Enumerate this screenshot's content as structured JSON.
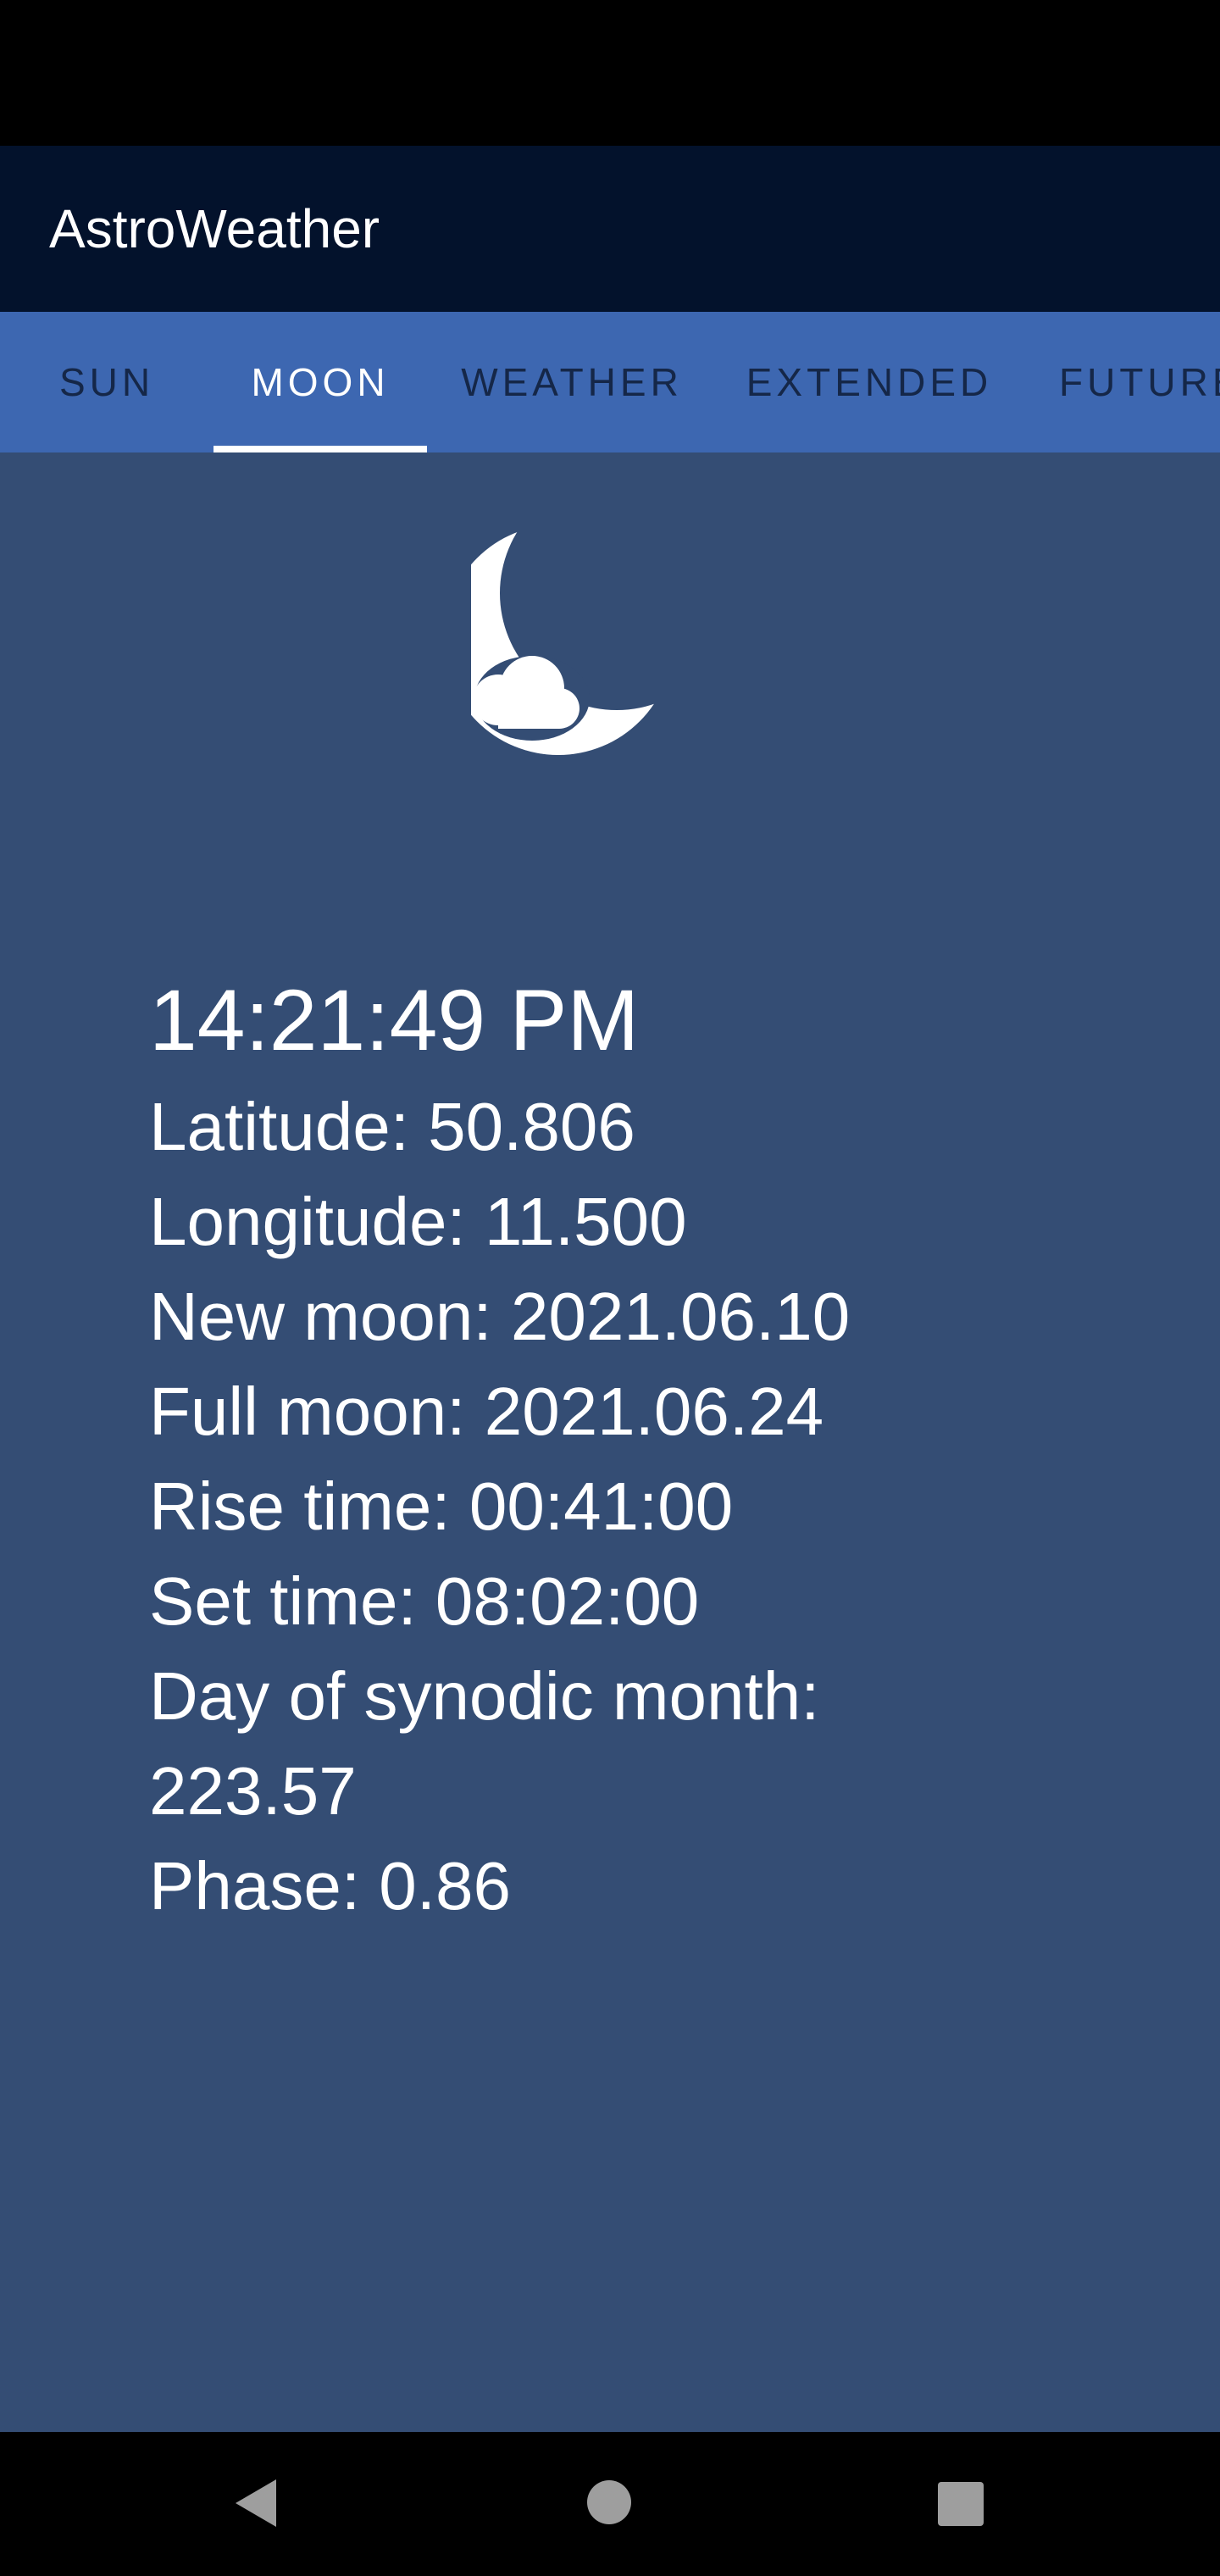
{
  "app": {
    "title": "AstroWeather"
  },
  "tabs": [
    {
      "label": "SUN",
      "selected": false
    },
    {
      "label": "MOON",
      "selected": true
    },
    {
      "label": "WEATHER",
      "selected": false
    },
    {
      "label": "EXTENDED",
      "selected": false
    },
    {
      "label": "FUTURE",
      "selected": false
    }
  ],
  "moon": {
    "icon": "moon-cloud-icon",
    "time": "14:21:49 PM",
    "latitude": "Latitude: 50.806",
    "longitude": "Longitude: 11.500",
    "new_moon": "New moon: 2021.06.10",
    "full_moon": "Full moon: 2021.06.24",
    "rise_time": "Rise time: 00:41:00",
    "set_time": "Set time: 08:02:00",
    "synodic_label": "Day of synodic month:",
    "synodic_value": "223.57",
    "phase": "Phase: 0.86"
  },
  "colors": {
    "app_bar": "#03122c",
    "tab_bar": "#3d67b1",
    "content_bg": "#344d74",
    "tab_text": "#152748",
    "selected_tab_text": "#ffffff"
  },
  "nav": {
    "back": "back-triangle-icon",
    "home": "home-circle-icon",
    "recents": "recents-square-icon"
  }
}
